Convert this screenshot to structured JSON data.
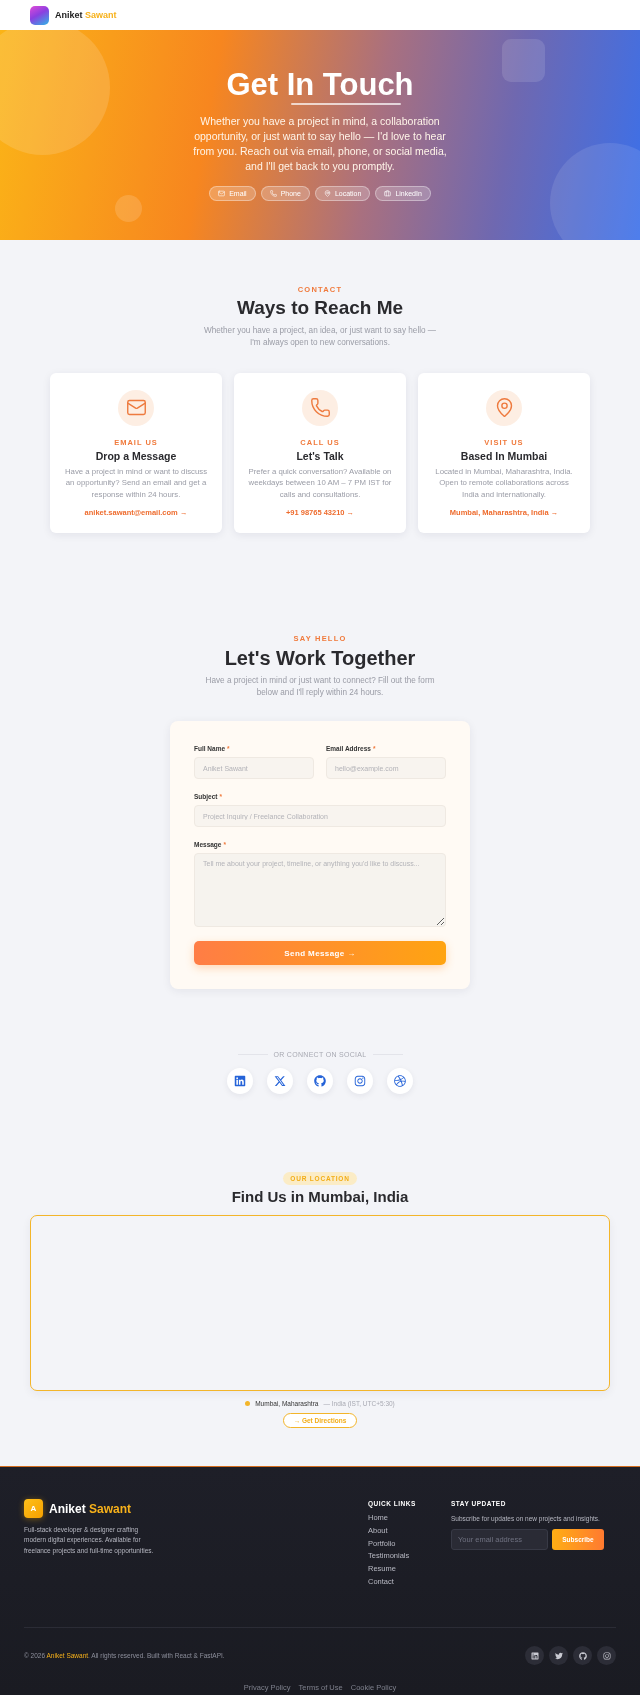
{
  "nav": {
    "brand": {
      "first": "Aniket",
      "accent": "Sawant"
    }
  },
  "hero": {
    "title": "Get In Touch",
    "text": "Whether you have a project in mind, a collaboration opportunity, or just want to say hello — I'd love to hear from you. Reach out via email, phone, or social media, and I'll get back to you promptly.",
    "chips": [
      {
        "kind": "email",
        "label": "Email"
      },
      {
        "kind": "phone",
        "label": "Phone"
      },
      {
        "kind": "location",
        "label": "Location"
      },
      {
        "kind": "linkedin",
        "label": "LinkedIn"
      }
    ]
  },
  "contact": {
    "eyebrow": "CONTACT",
    "title": "Ways to Reach Me",
    "subtitle": "Whether you have a project, an idea, or just want to say hello — I'm always open to new conversations.",
    "cards": [
      {
        "kind": "email",
        "eyebrow": "EMAIL US",
        "title": "Drop a Message",
        "text": "Have a project in mind or want to discuss an opportunity? Send an email and get a response within 24 hours.",
        "link": "aniket.sawant@email.com →"
      },
      {
        "kind": "phone",
        "eyebrow": "CALL US",
        "title": "Let's Talk",
        "text": "Prefer a quick conversation? Available on weekdays between 10 AM – 7 PM IST for calls and consultations.",
        "link": "+91 98765 43210 →"
      },
      {
        "kind": "location",
        "eyebrow": "VISIT US",
        "title": "Based In Mumbai",
        "text": "Located in Mumbai, Maharashtra, India. Open to remote collaborations across India and internationally.",
        "link": "Mumbai, Maharashtra, India →"
      }
    ]
  },
  "form_section": {
    "eyebrow": "SAY HELLO",
    "title": "Let's Work Together",
    "subtitle": "Have a project in mind or just want to connect? Fill out the form below and I'll reply within 24 hours.",
    "rows": [
      [
        {
          "kind": "input",
          "label": "Full Name",
          "mark": "*",
          "placeholder": "Aniket Sawant"
        },
        {
          "kind": "input",
          "label": "Email Address",
          "mark": "*",
          "placeholder": "hello@example.com"
        }
      ],
      [
        {
          "kind": "input",
          "label": "Subject",
          "mark": "*",
          "placeholder": "Project Inquiry / Freelance Collaboration"
        }
      ],
      [
        {
          "kind": "textarea",
          "label": "Message",
          "mark": "*",
          "placeholder": "Tell me about your project, timeline, or anything you'd like to discuss..."
        }
      ]
    ],
    "submit": "Send Message →"
  },
  "social": {
    "label": "OR CONNECT ON SOCIAL",
    "links": [
      {
        "kind": "linkedin"
      },
      {
        "kind": "x"
      },
      {
        "kind": "github"
      },
      {
        "kind": "instagram"
      },
      {
        "kind": "dribbble"
      }
    ]
  },
  "location": {
    "badge": "OUR LOCATION",
    "title": "Find Us in Mumbai, India",
    "place": "Mumbai, Maharashtra",
    "detail": "— India (IST, UTC+5:30)",
    "button": "→ Get Directions"
  },
  "footer": {
    "logo_letter": "A",
    "brand": {
      "first": "Aniket",
      "accent": "Sawant"
    },
    "description": "Full-stack developer & designer crafting modern digital experiences. Available for freelance projects and full-time opportunities.",
    "quick_links": {
      "title": "QUICK LINKS",
      "items": [
        "Home",
        "About",
        "Portfolio",
        "Testimonials",
        "Resume",
        "Contact"
      ]
    },
    "newsletter": {
      "title": "STAY UPDATED",
      "text": "Subscribe for updates on new projects and insights.",
      "placeholder": "Your email address",
      "button": "Subscribe"
    },
    "copyright": {
      "before": "© 2026",
      "name": "Aniket Sawant",
      "after": ". All rights reserved. Built with React & FastAPI."
    },
    "social": [
      {
        "kind": "linkedin"
      },
      {
        "kind": "twitter"
      },
      {
        "kind": "github"
      },
      {
        "kind": "instagram"
      }
    ],
    "legal": [
      "Privacy Policy",
      "Terms of Use",
      "Cookie Policy"
    ]
  }
}
